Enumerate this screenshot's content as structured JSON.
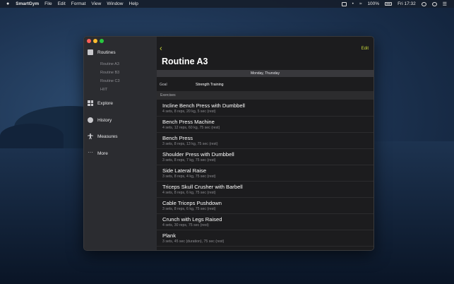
{
  "menubar": {
    "app_name": "SmartGym",
    "menus": [
      "File",
      "Edit",
      "Format",
      "View",
      "Window",
      "Help"
    ],
    "battery": "100%",
    "clock": "Fri 17:32"
  },
  "sidebar": {
    "items": [
      {
        "label": "Routines",
        "icon": "clipboard-icon"
      },
      {
        "label": "Explore",
        "icon": "grid-icon"
      },
      {
        "label": "History",
        "icon": "clock-icon"
      },
      {
        "label": "Measures",
        "icon": "body-icon"
      },
      {
        "label": "More",
        "icon": "more-icon"
      }
    ],
    "routines": [
      "Routine A3",
      "Routine B3",
      "Routine C3",
      "HIIT"
    ]
  },
  "main": {
    "edit_label": "Edit",
    "title": "Routine A3",
    "days": "Monday, Thursday",
    "goal_label": "Goal",
    "goal_value": "Strength Training",
    "section_title": "Exercises",
    "exercises": [
      {
        "name": "Incline Bench Press with Dumbbell",
        "detail": "4 sets, 8 reps, 20 kg, 5 sec (rest)"
      },
      {
        "name": "Bench Press Machine",
        "detail": "4 sets, 12 reps, 60 kg, 75 sec (rest)"
      },
      {
        "name": "Bench Press",
        "detail": "3 sets, 8 reps, 13 kg, 75 sec (rest)"
      },
      {
        "name": "Shoulder Press with Dumbbell",
        "detail": "3 sets, 8 reps, 7 kg, 75 sec (rest)"
      },
      {
        "name": "Side Lateral Raise",
        "detail": "3 sets, 8 reps, 4 kg, 75 sec (rest)"
      },
      {
        "name": "Triceps Skull Crusher with Barbell",
        "detail": "4 sets, 8 reps, 6 kg, 75 sec (rest)"
      },
      {
        "name": "Cable Triceps Pushdown",
        "detail": "3 sets, 8 reps, 6 kg, 75 sec (rest)"
      },
      {
        "name": "Crunch with Legs Raised",
        "detail": "4 sets, 30 reps, 75 sec (rest)"
      },
      {
        "name": "Plank",
        "detail": "3 sets, 45 sec (duration), 75 sec (rest)"
      }
    ]
  },
  "colors": {
    "accent": "#c9d73a",
    "sidebar_bg": "#2b2c30",
    "content_bg": "#1c1c1e"
  }
}
